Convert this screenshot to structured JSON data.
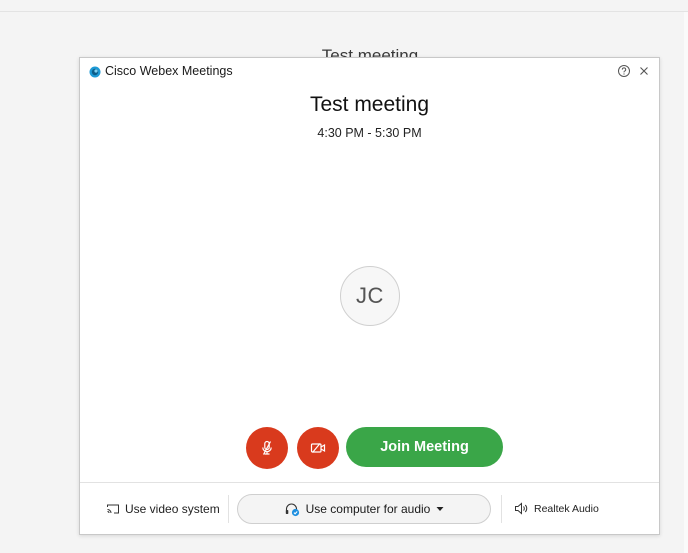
{
  "background": {
    "title": "Test meeting"
  },
  "window": {
    "app_name": "Cisco Webex Meetings"
  },
  "meeting": {
    "title": "Test meeting",
    "time": "4:30 PM - 5:30 PM",
    "avatar_initials": "JC"
  },
  "controls": {
    "join_label": "Join Meeting"
  },
  "footer": {
    "video_system_label": "Use video system",
    "audio_label": "Use computer for audio",
    "speaker_label": "Realtek Audio"
  },
  "colors": {
    "join_green": "#3aa648",
    "mute_red": "#d93a1d",
    "logo_blue": "#1d9ad6"
  },
  "icons": {
    "logo": "webex-logo-icon",
    "help": "help-icon",
    "close": "close-icon",
    "mute": "microphone-muted-icon",
    "video": "video-off-icon",
    "cast": "cast-icon",
    "headset": "headset-icon",
    "dropdown": "caret-down-icon",
    "speaker": "speaker-icon"
  }
}
